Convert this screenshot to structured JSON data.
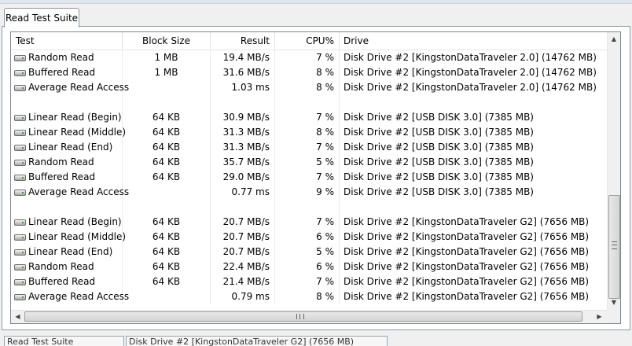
{
  "tab": {
    "label": "Read Test Suite"
  },
  "columns": {
    "test": "Test",
    "block_size": "Block Size",
    "result": "Result",
    "cpu": "CPU%",
    "drive": "Drive"
  },
  "rows": [
    {
      "test": "Random Read",
      "block_size": "1 MB",
      "result": "19.4 MB/s",
      "cpu": "7 %",
      "drive": "Disk Drive #2  [KingstonDataTraveler 2.0]  (14762 MB)"
    },
    {
      "test": "Buffered Read",
      "block_size": "1 MB",
      "result": "31.6 MB/s",
      "cpu": "8 %",
      "drive": "Disk Drive #2  [KingstonDataTraveler 2.0]  (14762 MB)"
    },
    {
      "test": "Average Read Access",
      "block_size": "",
      "result": "1.03 ms",
      "cpu": "8 %",
      "drive": "Disk Drive #2  [KingstonDataTraveler 2.0]  (14762 MB)"
    },
    {
      "blank": true
    },
    {
      "test": "Linear Read (Begin)",
      "block_size": "64 KB",
      "result": "30.9 MB/s",
      "cpu": "7 %",
      "drive": "Disk Drive #2  [USB DISK 3.0]  (7385 MB)"
    },
    {
      "test": "Linear Read (Middle)",
      "block_size": "64 KB",
      "result": "31.3 MB/s",
      "cpu": "8 %",
      "drive": "Disk Drive #2  [USB DISK 3.0]  (7385 MB)"
    },
    {
      "test": "Linear Read (End)",
      "block_size": "64 KB",
      "result": "31.3 MB/s",
      "cpu": "7 %",
      "drive": "Disk Drive #2  [USB DISK 3.0]  (7385 MB)"
    },
    {
      "test": "Random Read",
      "block_size": "64 KB",
      "result": "35.7 MB/s",
      "cpu": "5 %",
      "drive": "Disk Drive #2  [USB DISK 3.0]  (7385 MB)"
    },
    {
      "test": "Buffered Read",
      "block_size": "64 KB",
      "result": "29.0 MB/s",
      "cpu": "7 %",
      "drive": "Disk Drive #2  [USB DISK 3.0]  (7385 MB)"
    },
    {
      "test": "Average Read Access",
      "block_size": "",
      "result": "0.77 ms",
      "cpu": "9 %",
      "drive": "Disk Drive #2  [USB DISK 3.0]  (7385 MB)"
    },
    {
      "blank": true
    },
    {
      "test": "Linear Read (Begin)",
      "block_size": "64 KB",
      "result": "20.7 MB/s",
      "cpu": "7 %",
      "drive": "Disk Drive #2  [KingstonDataTraveler G2]  (7656 MB)"
    },
    {
      "test": "Linear Read (Middle)",
      "block_size": "64 KB",
      "result": "20.7 MB/s",
      "cpu": "6 %",
      "drive": "Disk Drive #2  [KingstonDataTraveler G2]  (7656 MB)"
    },
    {
      "test": "Linear Read (End)",
      "block_size": "64 KB",
      "result": "20.7 MB/s",
      "cpu": "5 %",
      "drive": "Disk Drive #2  [KingstonDataTraveler G2]  (7656 MB)"
    },
    {
      "test": "Random Read",
      "block_size": "64 KB",
      "result": "22.4 MB/s",
      "cpu": "6 %",
      "drive": "Disk Drive #2  [KingstonDataTraveler G2]  (7656 MB)"
    },
    {
      "test": "Buffered Read",
      "block_size": "64 KB",
      "result": "21.4 MB/s",
      "cpu": "7 %",
      "drive": "Disk Drive #2  [KingstonDataTraveler G2]  (7656 MB)"
    },
    {
      "test": "Average Read Access",
      "block_size": "",
      "result": "0.79 ms",
      "cpu": "8 %",
      "drive": "Disk Drive #2  [KingstonDataTraveler G2]  (7656 MB)"
    }
  ],
  "status_bar": {
    "left": "Read Test Suite",
    "right": "Disk Drive #2  [KingstonDataTraveler G2]  (7656 MB)"
  },
  "icons": {
    "row": "drive-icon",
    "scroll_up": "arrow-up-icon",
    "scroll_down": "arrow-down-icon",
    "scroll_left": "arrow-left-icon",
    "scroll_right": "arrow-right-icon"
  }
}
